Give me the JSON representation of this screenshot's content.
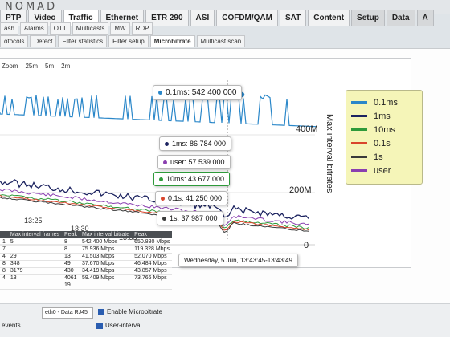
{
  "brand": {
    "logo_text": "NOMAD"
  },
  "main_tabs": [
    {
      "label": "PTP"
    },
    {
      "label": "Video"
    },
    {
      "label": "Traffic"
    },
    {
      "label": "Ethernet"
    },
    {
      "label": "ETR 290"
    },
    {
      "label": "ASI"
    },
    {
      "label": "COFDM/QAM"
    },
    {
      "label": "SAT"
    },
    {
      "label": "Content"
    },
    {
      "label": "Setup"
    },
    {
      "label": "Data"
    },
    {
      "label": "A"
    }
  ],
  "sub_tabs_row1": [
    {
      "label": "ash"
    },
    {
      "label": "Alarms"
    },
    {
      "label": "OTT"
    },
    {
      "label": "Multicasts"
    },
    {
      "label": "MW"
    },
    {
      "label": "RDP"
    }
  ],
  "sub_tabs_row2": [
    {
      "label": "otocols"
    },
    {
      "label": "Detect"
    },
    {
      "label": "Filter statistics"
    },
    {
      "label": "Filter setup"
    },
    {
      "label": "Microbitrate"
    },
    {
      "label": "Multicast scan"
    }
  ],
  "zoom": {
    "label": "Zoom",
    "options": [
      "25m",
      "5m",
      "2m"
    ]
  },
  "chart_data": {
    "type": "line",
    "ylabel": "Max interval bitrates",
    "yticks": [
      "400M",
      "200M",
      "0"
    ],
    "xticks": [
      "13:25",
      "13:30",
      "13:35"
    ],
    "series": [
      {
        "name": "0.1ms",
        "color": "#2a87c9"
      },
      {
        "name": "1ms",
        "color": "#1c2360"
      },
      {
        "name": "10ms",
        "color": "#2e9a3a"
      },
      {
        "name": "0.1s",
        "color": "#d9452b"
      },
      {
        "name": "1s",
        "color": "#3a3a3a"
      },
      {
        "name": "user",
        "color": "#8a3fb0"
      }
    ],
    "tooltips": {
      "t01ms": "0.1ms: 542 400 000",
      "t1ms": "1ms: 86 784 000",
      "tuser": "user: 57 539 000",
      "t10ms": "10ms: 43 677 000",
      "t01s": "0.1s: 41 250 000",
      "t1s": "1s: 37 987 000",
      "date": "Wednesday, 5 Jun, 13:43:45-13:43:49"
    }
  },
  "table": {
    "headers_left": [
      "",
      "Max interval frames",
      "Peak"
    ],
    "headers_right": [
      "Max interval bitrate",
      "Peak"
    ],
    "rows": [
      [
        "1",
        "5",
        "8",
        "542.400 Mbps",
        "650.880 Mbps"
      ],
      [
        "7",
        "",
        "8",
        "75.936 Mbps",
        "119.328 Mbps"
      ],
      [
        "4",
        "29",
        "13",
        "41.503 Mbps",
        "52.070 Mbps"
      ],
      [
        "8",
        "348",
        "49",
        "37.670 Mbps",
        "46.484 Mbps"
      ],
      [
        "8",
        "3179",
        "430",
        "34.419 Mbps",
        "43.857 Mbps"
      ],
      [
        "4",
        "13",
        "4061",
        "59.409 Mbps",
        "73.766 Mbps"
      ],
      [
        "",
        "",
        "19",
        "",
        ""
      ]
    ]
  },
  "bottom": {
    "interface_select": "eth0 - Data RJ45",
    "enable_label": "Enable Microbitrate",
    "user_interval_label": "User-interval",
    "events_label": "events"
  }
}
